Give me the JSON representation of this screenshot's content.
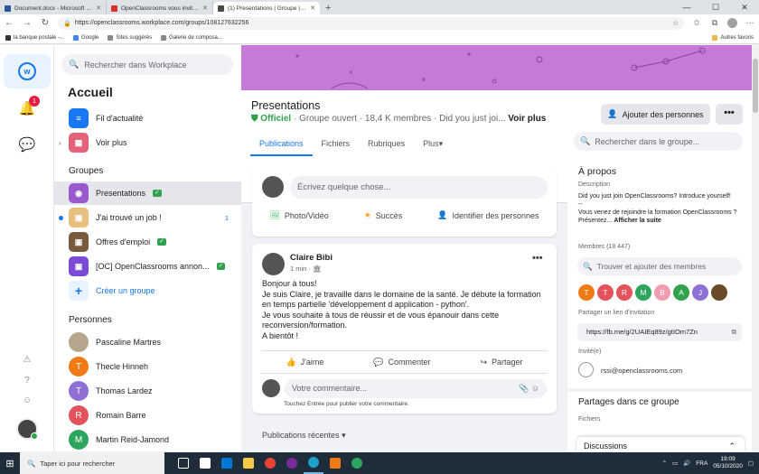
{
  "browser": {
    "tabs": [
      {
        "title": "Document.docx - Microsoft Word",
        "color": "#2b579a"
      },
      {
        "title": "OpenClassrooms vous invite à rejoindre",
        "color": "#d93025"
      },
      {
        "title": "(1) Presentations | Groupe | Workplace",
        "color": "#4a4a4a"
      }
    ],
    "new_tab": "+",
    "url": "https://openclassrooms.workplace.com/groups/108127632256",
    "bookmarks": [
      "la banque postale -...",
      "Google",
      "Sites suggérés",
      "Galerie de composa..."
    ],
    "bookmarks_right": "Autres favoris"
  },
  "sidebar": {
    "search_placeholder": "Rechercher dans Workplace",
    "title": "Accueil",
    "nav": [
      {
        "label": "Fil d'actualité",
        "color": "#1877f2"
      },
      {
        "label": "Voir plus",
        "color": "#e4637a"
      }
    ],
    "groups_header": "Groupes",
    "groups": [
      {
        "label": "Presentations",
        "color": "#9b59d0",
        "selected": true
      },
      {
        "label": "J'ai trouvé un job !",
        "color": "#e8c07d",
        "count": "1"
      },
      {
        "label": "Offres d'emploi",
        "color": "#7a5a3c"
      },
      {
        "label": "[OC] OpenClassrooms annon...",
        "color": "#7b4ad6"
      }
    ],
    "create_group": "Créer un groupe",
    "people_header": "Personnes",
    "people": [
      {
        "name": "Pascaline Martres",
        "initial": "",
        "color": "#b6a68e"
      },
      {
        "name": "Thecle Hinneh",
        "initial": "T",
        "color": "#f07b16"
      },
      {
        "name": "Thomas Lardez",
        "initial": "T",
        "color": "#8f6fd4"
      },
      {
        "name": "Romain Barre",
        "initial": "R",
        "color": "#e4525c"
      },
      {
        "name": "Martin Reid-Jamond",
        "initial": "M",
        "color": "#2ea55e"
      }
    ],
    "notif_count": "1"
  },
  "group": {
    "title": "Presentations",
    "official": "Officiel",
    "meta": " · Groupe ouvert · 18,4 K membres · Did you just joi...",
    "more": "Voir plus",
    "add_people": "Ajouter des personnes",
    "dots": "•••",
    "tabs": [
      "Publications",
      "Fichiers",
      "Rubriques",
      "Plus"
    ],
    "search_placeholder": "Rechercher dans le groupe..."
  },
  "composer": {
    "placeholder": "Écrivez quelque chose...",
    "actions": [
      "Photo/Vidéo",
      "Succès",
      "Identifier des personnes"
    ]
  },
  "post": {
    "author": "Claire Bibi",
    "time": "1 min · 🏛",
    "lines": [
      "Bonjour à tous!",
      "Je suis Claire, je travaille dans le domaine de la santé. Je débute la formation en temps partielle 'développement d application -  python'.",
      "Je vous souhaite à tous de réussir et de vous épanouir dans cette reconversion/formation.",
      "A bientôt !"
    ],
    "actions": [
      "J'aime",
      "Commenter",
      "Partager"
    ],
    "comment_placeholder": "Votre commentaire...",
    "hint": "Touchez Entrée pour publier votre commentaire."
  },
  "recent": "Publications récentes",
  "about": {
    "title": "À propos",
    "desc_label": "Description",
    "desc_1": "Did you just join OpenClassrooms? Introduce yourself!",
    "desc_2": "--",
    "desc_3": "Vous venez de rejoindre la formation OpenClassrooms ? Présentez...",
    "see_more": "Afficher la suite",
    "members_label": "Membres (18 447)",
    "member_search": "Trouver et ajouter des membres",
    "member_avatars": [
      {
        "i": "T",
        "c": "#f07b16"
      },
      {
        "i": "T",
        "c": "#e4525c"
      },
      {
        "i": "R",
        "c": "#e4525c"
      },
      {
        "i": "M",
        "c": "#2ea55e"
      },
      {
        "i": "B",
        "c": "#f39cb0"
      },
      {
        "i": "A",
        "c": "#31a24c"
      },
      {
        "i": "J",
        "c": "#8f6fd4"
      },
      {
        "i": "",
        "c": "#6b4a2a"
      }
    ],
    "share_label": "Partager un lien d'invitation",
    "share_link": "https://fb.me/g/2UAIEq89z/gtIOm7Zn",
    "invited_label": "Invité(e)",
    "invited_email": "rssi@openclassrooms.com",
    "shared_title": "Partages dans ce groupe",
    "files_label": "Fichiers"
  },
  "discussions": "Discussions",
  "taskbar": {
    "search": "Taper ici pour rechercher",
    "lang": "FRA",
    "time": "19:09",
    "date": "05/10/2020"
  }
}
